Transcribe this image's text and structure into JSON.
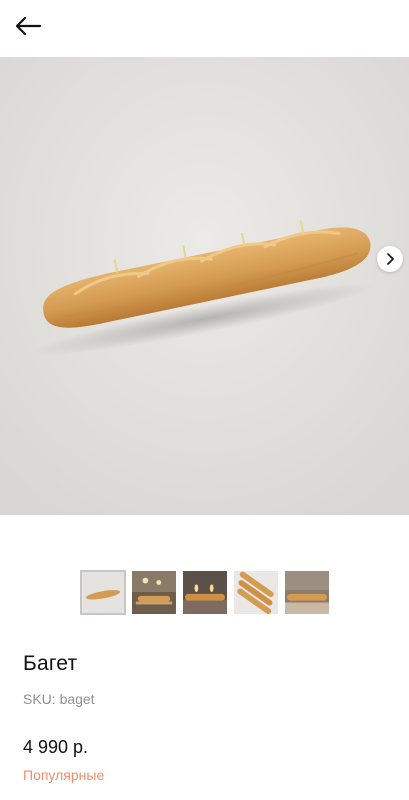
{
  "header": {
    "back_icon": "arrow-left-icon"
  },
  "gallery": {
    "next_icon": "chevron-right-icon",
    "thumbnails": [
      "baguette-front",
      "baguette-lit-candles-shelf",
      "baguette-lit-side",
      "three-baguettes",
      "baguette-side"
    ],
    "active_index": 0
  },
  "product": {
    "title": "Багет",
    "sku": "SKU: baget",
    "price": "4 990 р.",
    "badge": "Популярные"
  },
  "colors": {
    "badge": "#ef8e6d",
    "background": "#e2e1dd",
    "bread": "#d49b52"
  }
}
